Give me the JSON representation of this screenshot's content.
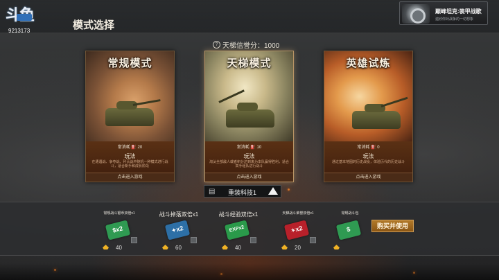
{
  "header": {
    "logo_text": "斗鱼",
    "room_id": "9213173",
    "title": "模式选择"
  },
  "promo": {
    "title": "巅峰坦克:装甲战歌",
    "subtitle": "遍欣你对战争的一切想象"
  },
  "ladder": {
    "label": "天梯信誉分：1000"
  },
  "modes": [
    {
      "title": "常规模式",
      "cost": "常消耗 ⛽ 20",
      "play_label": "玩法",
      "desc": "在遭遇战、争夺战、歼灭战中随机一种模式进行战斗，适合新手和成长阶段",
      "enter": "点击进入游戏",
      "selected": false
    },
    {
      "title": "天梯模式",
      "cost": "常消耗 ⛽ 10",
      "play_label": "玩法",
      "desc": "淘汰全部敌人或者积分达到来为本队赢得胜利，适合高手组队进行战斗",
      "enter": "点击进入游戏",
      "selected": true
    },
    {
      "title": "英雄试炼",
      "cost": "常消耗 ⛽ 0",
      "play_label": "玩法",
      "desc": "通过基本地图的历史战役，体验历代的历史战斗",
      "enter": "点击进入游戏",
      "selected": false
    }
  ],
  "tech_selector": {
    "icon": "document-icon",
    "label": "重装科技1"
  },
  "items": [
    {
      "name": "常规战斗银币双倍x1",
      "ticket_text": "$x2",
      "color": "#2f9a52",
      "count": "40",
      "size": "small"
    },
    {
      "name": "战斗掉落双倍x1",
      "ticket_text": "✦x2",
      "color": "#2d6fa6",
      "count": "60",
      "size": "big"
    },
    {
      "name": "战斗经验双倍x1",
      "ticket_text": "EXPx2",
      "color": "#2a9a4a",
      "count": "40",
      "size": "big"
    },
    {
      "name": "天梯战斗荣誉双倍x1",
      "ticket_text": "✶x2",
      "color": "#b8202a",
      "count": "20",
      "size": "small"
    },
    {
      "name": "常规战斗包",
      "ticket_text": "$",
      "color": "#2f9a52",
      "count": "",
      "size": "small"
    }
  ],
  "buy_button": "购买并使用"
}
